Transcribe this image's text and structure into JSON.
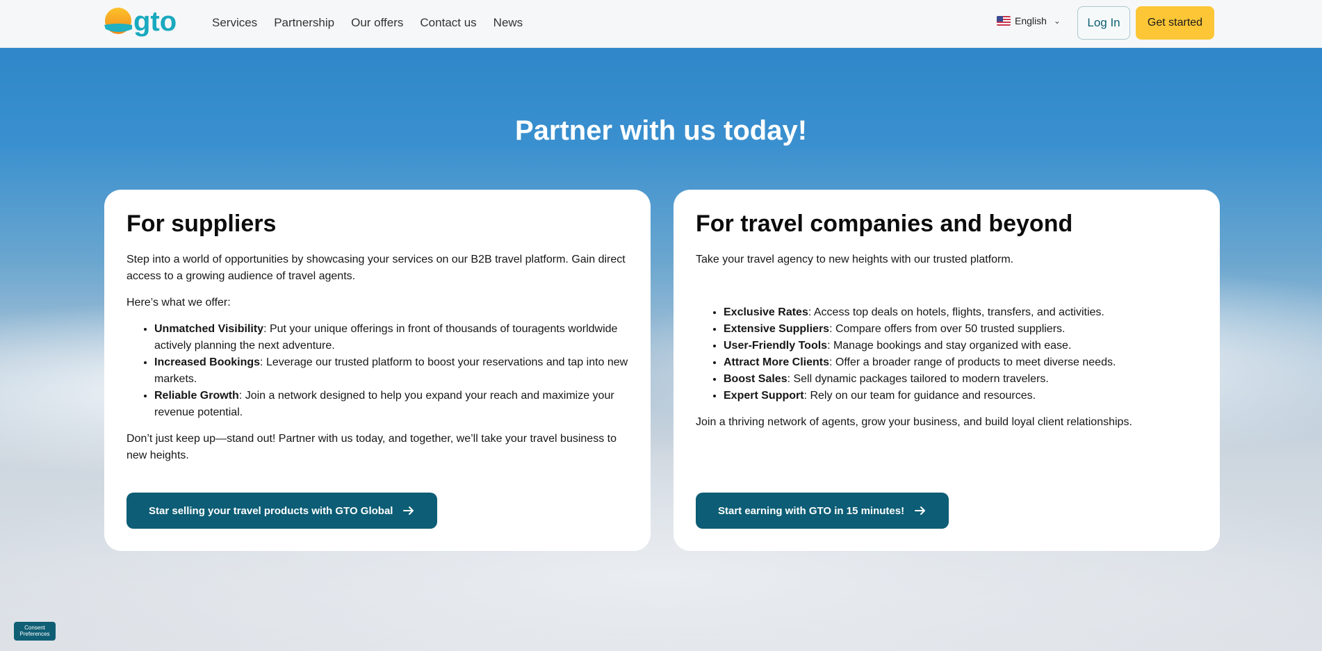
{
  "header": {
    "logo_text": "gto",
    "nav": [
      "Services",
      "Partnership",
      "Our offers",
      "Contact us",
      "News"
    ],
    "language": "English",
    "login_label": "Log In",
    "get_started_label": "Get started"
  },
  "hero": {
    "title": "Partner with us today!"
  },
  "suppliers": {
    "title": "For suppliers",
    "intro": "Step into a world of opportunities by showcasing your services on our B2B travel platform. Gain direct access to a growing audience of travel agents.",
    "offer_lead": "Here’s what we offer:",
    "items": [
      {
        "title": "Unmatched Visibility",
        "text": ": Put your unique offerings in front of thousands of touragents worldwide actively planning the next adventure."
      },
      {
        "title": "Increased Bookings",
        "text": ": Leverage our trusted platform to boost your reservations and tap into new markets."
      },
      {
        "title": "Reliable Growth",
        "text": ": Join a network designed to help you expand your reach and maximize your revenue potential."
      }
    ],
    "outro": "Don’t just keep up—stand out! Partner with us today, and together, we’ll take your travel business to new heights.",
    "cta_label": "Star selling your travel products with GTO Global"
  },
  "travel": {
    "title": "For travel companies and beyond",
    "intro": "Take your travel agency to new heights with our trusted platform.",
    "items": [
      {
        "title": "Exclusive Rates",
        "text": ": Access top deals on hotels, flights, transfers, and activities."
      },
      {
        "title": "Extensive Suppliers",
        "text": ": Compare offers from over 50 trusted suppliers."
      },
      {
        "title": "User-Friendly Tools",
        "text": ": Manage bookings and stay organized with ease."
      },
      {
        "title": "Attract More Clients",
        "text": ": Offer a broader range of products to meet diverse needs."
      },
      {
        "title": "Boost Sales",
        "text": ": Sell dynamic packages tailored to modern travelers."
      },
      {
        "title": "Expert Support",
        "text": ": Rely on our team for guidance and resources."
      }
    ],
    "outro": "Join a thriving network of agents, grow your business, and build loyal client relationships.",
    "cta_label": "Start earning with GTO in 15 minutes!"
  },
  "consent": {
    "line1": "Consent",
    "line2": "Preferences"
  },
  "colors": {
    "primary": "#0c5d75",
    "accent": "#fcc636",
    "sky": "#2a82c6"
  },
  "icons": {
    "cta_arrow": "arrow-right-icon",
    "language_flag": "us-flag-icon",
    "dropdown": "chevron-down-icon"
  }
}
